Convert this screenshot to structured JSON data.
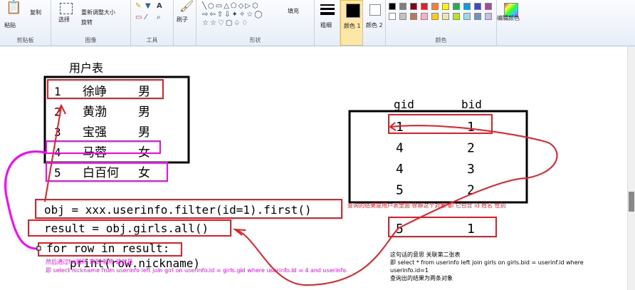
{
  "ribbon": {
    "clipboard": {
      "paste": "粘贴",
      "copy": "复制",
      "group": "剪贴板"
    },
    "image": {
      "select": "选择",
      "resize": "重新调整大小",
      "rotate": "旋转",
      "group": "图像"
    },
    "tools": {
      "group": "工具"
    },
    "brush": {
      "label": "刷子"
    },
    "shapes": {
      "fill": "填充",
      "group": "形状"
    },
    "size": {
      "label": "粗细"
    },
    "color1": {
      "label": "颜色 1"
    },
    "color2": {
      "label": "颜色 2"
    },
    "colors": {
      "group": "颜色"
    },
    "edit_colors": {
      "label": "编辑颜色"
    },
    "palette": [
      "#000000",
      "#7f7f7f",
      "#880015",
      "#ed1c24",
      "#ff7f27",
      "#fff200",
      "#22b14c",
      "#00a2e8",
      "#3f48cc",
      "#a349a4",
      "#ffffff",
      "#c3c3c3",
      "#b97a57",
      "#ffaec9",
      "#ffc90e",
      "#efe4b0",
      "#b5e61d",
      "#99d9ea",
      "#7092be",
      "#c8bfe7"
    ]
  },
  "drawing": {
    "table_title": "用户表",
    "users": [
      {
        "id": "1",
        "name": "徐峥",
        "gender": "男"
      },
      {
        "id": "2",
        "name": "黄渤",
        "gender": "男"
      },
      {
        "id": "3",
        "name": "宝强",
        "gender": "男"
      },
      {
        "id": "4",
        "name": "马蓉",
        "gender": "女"
      },
      {
        "id": "5",
        "name": "白百何",
        "gender": "女"
      }
    ],
    "girls_header": {
      "gid": "gid",
      "bid": "bid"
    },
    "girls_rows": [
      {
        "gid": "1",
        "bid": "1"
      },
      {
        "gid": "4",
        "bid": "2"
      },
      {
        "gid": "4",
        "bid": "3"
      },
      {
        "gid": "5",
        "bid": "2"
      },
      {
        "gid": "5",
        "bid": "1"
      }
    ],
    "code": {
      "line1": "obj = xxx.userinfo.filter(id=1).first()",
      "line2": "result = obj.girls.all()",
      "line3": "for row in result:",
      "line4": "print(row.nickname)"
    },
    "note_query": "查询的结果是用户表里面  徐峥这个对象  即 它包含 id 姓名 性别",
    "note_bottom1": "然后通过for循环 拿到 昵称 这就是",
    "note_bottom2": "即  select  nickname from userinfo left join girl on userinfo.id = girls.gid where userinfo.id = 4 and userinfo.",
    "explain_title": "这句话的意思  关联第二张表",
    "explain_line1": "即  select * from userinfo left join girls on girls.bid = userinf.id where",
    "explain_line2": "userinfo.id=1",
    "explain_line3": "查询出的结果为两条对象",
    "colors": {
      "red": "#ed1c24",
      "magenta": "#ff00ff",
      "black": "#000000"
    }
  }
}
